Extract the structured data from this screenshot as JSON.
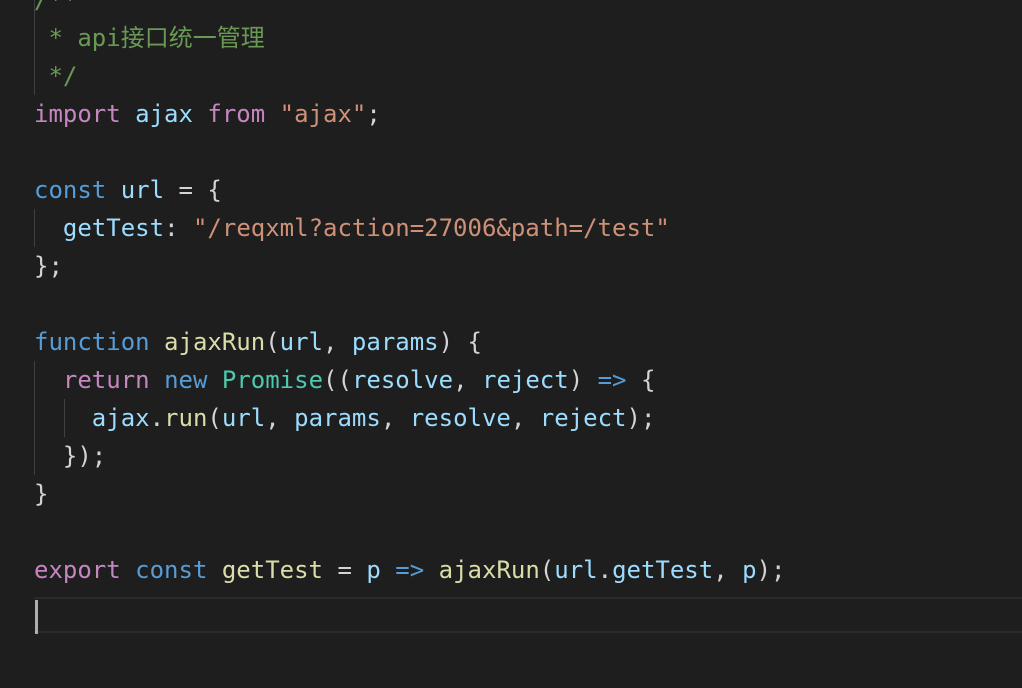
{
  "code": {
    "l1": {
      "comment": "/**"
    },
    "l2": {
      "comment": " * api接口统一管理"
    },
    "l3": {
      "comment": " */"
    },
    "l4": {
      "import": "import",
      "name": "ajax",
      "from": "from",
      "module": "\"ajax\"",
      "end": ";"
    },
    "l6": {
      "const": "const",
      "name": "url",
      "eq": " = {"
    },
    "l7": {
      "key": "getTest",
      "colon": ": ",
      "value": "\"/reqxml?action=27006&path=/test\""
    },
    "l8": {
      "text": "};"
    },
    "l10": {
      "function": "function",
      "name": "ajaxRun",
      "open": "(",
      "p1": "url",
      "comma": ", ",
      "p2": "params",
      "close": ") {"
    },
    "l11": {
      "return": "return",
      "new": "new",
      "cls": "Promise",
      "open": "((",
      "p1": "resolve",
      "comma": ", ",
      "p2": "reject",
      "close": ") ",
      "arrow": "=>",
      "brace": " {"
    },
    "l12": {
      "obj": "ajax",
      "dot": ".",
      "method": "run",
      "open": "(",
      "a1": "url",
      "c1": ", ",
      "a2": "params",
      "c2": ", ",
      "a3": "resolve",
      "c3": ", ",
      "a4": "reject",
      "close": ");"
    },
    "l13": {
      "text": "});"
    },
    "l14": {
      "text": "}"
    },
    "l16": {
      "export": "export",
      "const": "const",
      "name": "getTest",
      "eq": " = ",
      "param": "p",
      "arrow": "=>",
      "call": "ajaxRun",
      "open": "(",
      "obj": "url",
      "dot": ".",
      "prop": "getTest",
      "comma": ", ",
      "arg": "p",
      "close": ");"
    }
  },
  "colors": {
    "background": "#1e1e1e",
    "comment": "#6a9955",
    "keyword_control": "#c586c0",
    "keyword": "#569cd6",
    "variable": "#9cdcfe",
    "function": "#dcdcaa",
    "string": "#ce9178",
    "class": "#4ec9b0"
  }
}
